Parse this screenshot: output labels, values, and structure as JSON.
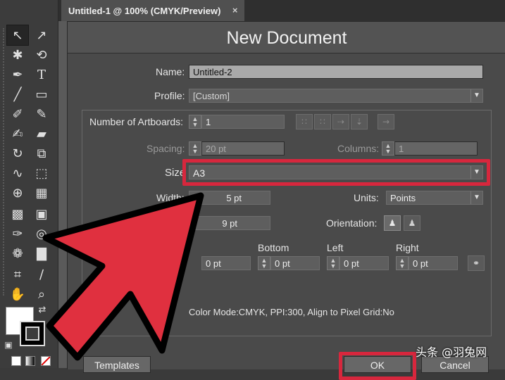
{
  "tab": {
    "title": "Untitled-1 @ 100% (CMYK/Preview)",
    "close_glyph": "×"
  },
  "dialog": {
    "title": "New Document",
    "name_label": "Name:",
    "name_value": "Untitled-2",
    "profile_label": "Profile:",
    "profile_value": "[Custom]",
    "artboards_label": "Number of Artboards:",
    "artboards_value": "1",
    "spacing_label": "Spacing:",
    "spacing_value": "20 pt",
    "columns_label": "Columns:",
    "columns_value": "1",
    "size_label": "Size",
    "size_value": "A3",
    "width_label": "Width:",
    "width_value": "5 pt",
    "units_label": "Units:",
    "units_value": "Points",
    "height_value": "9 pt",
    "orientation_label": "Orientation:",
    "bleed": {
      "top_value": "0 pt",
      "bottom_label": "Bottom",
      "bottom_value": "0 pt",
      "left_label": "Left",
      "left_value": "0 pt",
      "right_label": "Right",
      "right_value": "0 pt"
    },
    "info": "Color Mode:CMYK, PPI:300, Align to Pixel Grid:No",
    "templates_label": "Templates",
    "ok_label": "OK",
    "cancel_label": "Cancel"
  },
  "watermark": "头条 @羽兔网",
  "colors": {
    "highlight": "#d7273d",
    "arrow_fill": "#e0303f",
    "arrow_stroke": "#000000"
  }
}
